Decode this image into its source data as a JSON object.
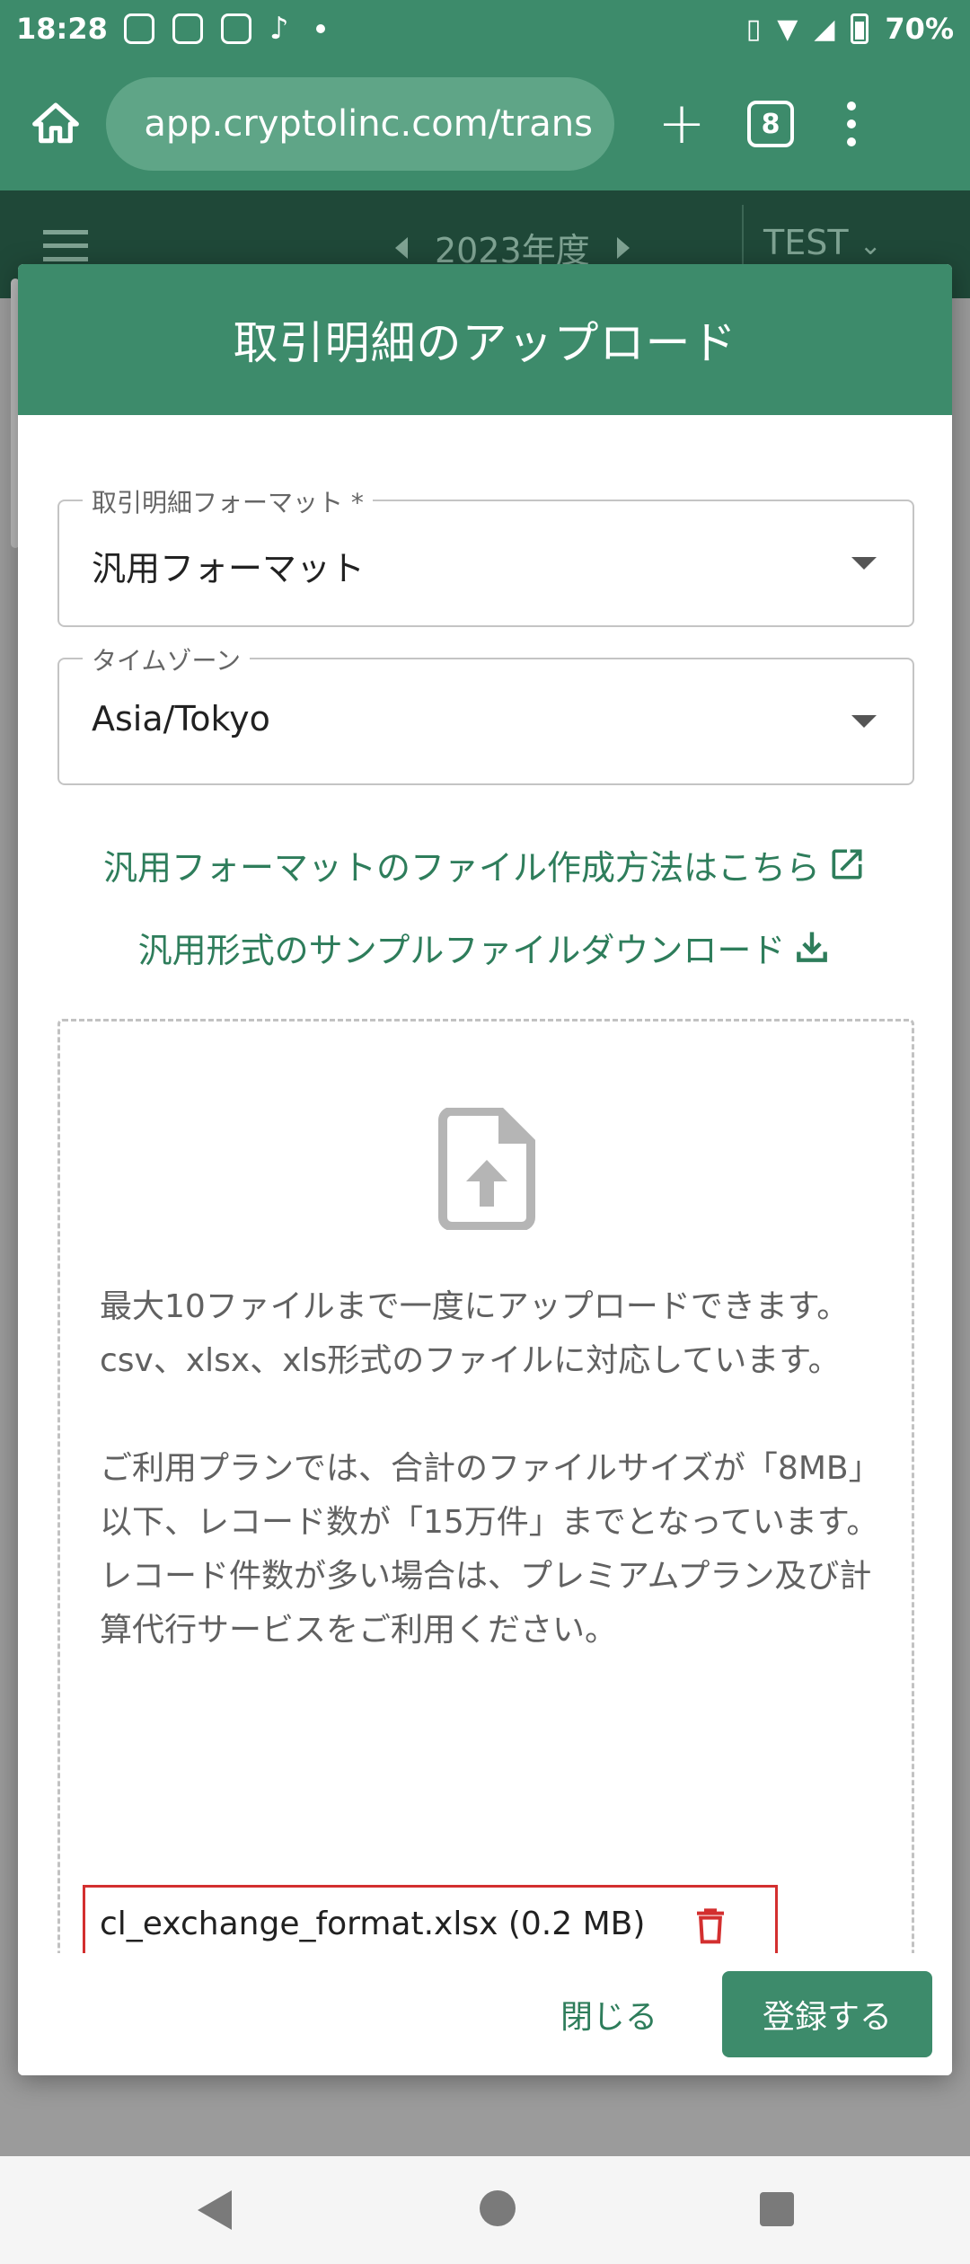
{
  "statusbar": {
    "time": "18:28",
    "battery": "70%"
  },
  "browser": {
    "url": "app.cryptolinc.com/trans",
    "tab_count": "8"
  },
  "app_header": {
    "year": "2023年度",
    "account": "TEST"
  },
  "modal": {
    "title": "取引明細のアップロード",
    "format_field": {
      "label": "取引明細フォーマット *",
      "value": "汎用フォーマット"
    },
    "timezone_field": {
      "label": "タイムゾーン",
      "value": "Asia/Tokyo"
    },
    "link_create": "汎用フォーマットのファイル作成方法はこちら",
    "link_sample": "汎用形式のサンプルファイルダウンロード",
    "dropzone_text": "最大10ファイルまで一度にアップロードできます。\ncsv、xlsx、xls形式のファイルに対応しています。\n\nご利用プランでは、合計のファイルサイズが「8MB」以下、レコード数が「15万件」までとなっています。\nレコード件数が多い場合は、プレミアムプラン及び計算代行サービスをご利用ください。",
    "uploaded_file": "cl_exchange_format.xlsx (0.2 MB)",
    "close_label": "閉じる",
    "submit_label": "登録する"
  },
  "colors": {
    "primary": "#3d8b6b",
    "link": "#2e7d5b",
    "danger": "#d32f2f"
  }
}
